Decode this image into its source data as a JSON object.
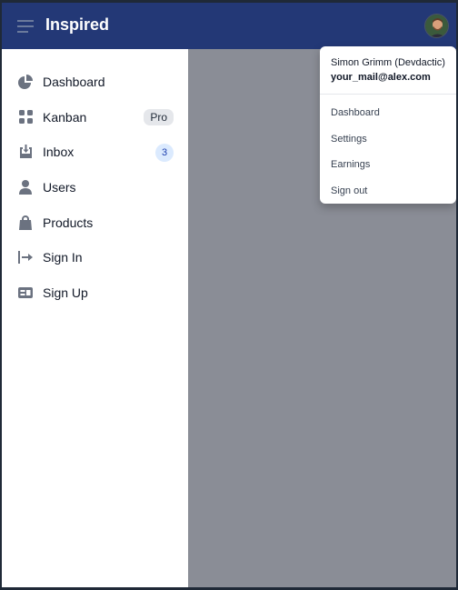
{
  "header": {
    "title": "Inspired",
    "menu_icon": "hamburger-icon",
    "avatar": "user-avatar"
  },
  "sidebar": {
    "items": [
      {
        "label": "Dashboard",
        "icon": "chart-pie-icon"
      },
      {
        "label": "Kanban",
        "icon": "grid-icon",
        "badge": "Pro"
      },
      {
        "label": "Inbox",
        "icon": "inbox-icon",
        "badge": "3"
      },
      {
        "label": "Users",
        "icon": "user-icon"
      },
      {
        "label": "Products",
        "icon": "shopping-bag-icon"
      },
      {
        "label": "Sign In",
        "icon": "sign-in-icon"
      },
      {
        "label": "Sign Up",
        "icon": "sign-up-icon"
      }
    ]
  },
  "user_menu": {
    "name": "Simon Grimm (Devdactic)",
    "email": "your_mail@alex.com",
    "items": [
      "Dashboard",
      "Settings",
      "Earnings",
      "Sign out"
    ]
  },
  "colors": {
    "topbar": "#233876",
    "overlay": "#8a8d96",
    "icon": "#6b7280"
  }
}
